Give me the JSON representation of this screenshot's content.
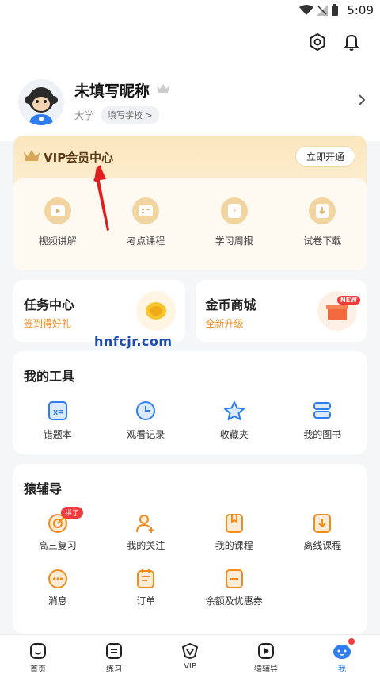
{
  "status": {
    "time": "5:09"
  },
  "profile": {
    "nickname": "未填写昵称",
    "university": "大学",
    "school_button": "填写学校 >"
  },
  "vip": {
    "title": "VIP会员中心",
    "open_button": "立即开通",
    "items": [
      {
        "label": "视频讲解",
        "icon": "video-icon"
      },
      {
        "label": "考点课程",
        "icon": "course-icon"
      },
      {
        "label": "学习周报",
        "icon": "weekly-report-icon"
      },
      {
        "label": "试卷下载",
        "icon": "download-icon"
      }
    ]
  },
  "task_center": {
    "title": "任务中心",
    "subtitle": "签到得好礼"
  },
  "coin_mall": {
    "title": "金币商城",
    "subtitle": "全新升级",
    "badge": "NEW"
  },
  "watermark": "hnfcjr.com",
  "tools": {
    "title": "我的工具",
    "items": [
      {
        "label": "错题本",
        "icon": "wrong-questions-icon"
      },
      {
        "label": "观看记录",
        "icon": "clock-icon"
      },
      {
        "label": "收藏夹",
        "icon": "star-icon"
      },
      {
        "label": "我的图书",
        "icon": "books-icon"
      }
    ]
  },
  "fudao": {
    "title": "猿辅导",
    "badge": "拼了",
    "row1": [
      {
        "label": "高三复习",
        "icon": "target-icon"
      },
      {
        "label": "我的关注",
        "icon": "follow-icon"
      },
      {
        "label": "我的课程",
        "icon": "my-course-icon"
      },
      {
        "label": "离线课程",
        "icon": "offline-course-icon"
      }
    ],
    "row2": [
      {
        "label": "消息",
        "icon": "message-icon"
      },
      {
        "label": "订单",
        "icon": "order-icon"
      },
      {
        "label": "余额及优惠券",
        "icon": "balance-icon"
      }
    ]
  },
  "tabs": [
    {
      "label": "首页",
      "icon": "home-icon"
    },
    {
      "label": "练习",
      "icon": "practice-icon"
    },
    {
      "label": "VIP",
      "icon": "vip-icon"
    },
    {
      "label": "猿辅导",
      "icon": "fudao-icon"
    },
    {
      "label": "我",
      "icon": "me-icon",
      "active": true
    }
  ]
}
